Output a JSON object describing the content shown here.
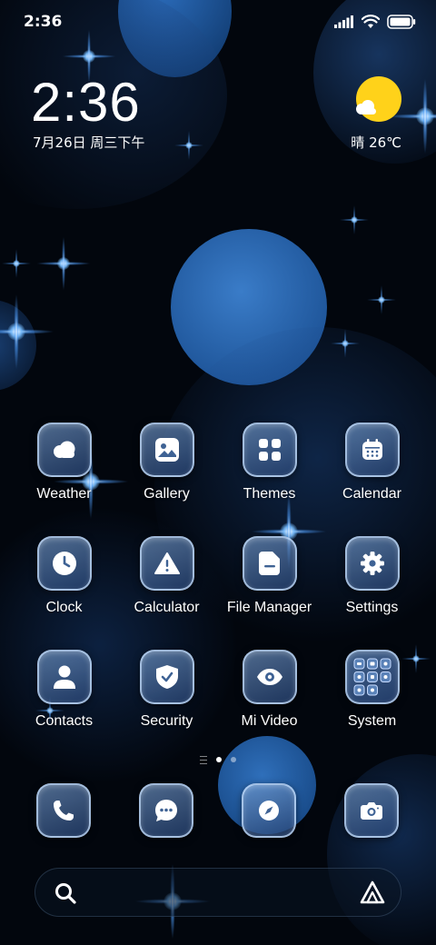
{
  "status_bar": {
    "time": "2:36",
    "icons": [
      "signal-icon",
      "wifi-icon",
      "battery-icon"
    ]
  },
  "clock_widget": {
    "time": "2:36",
    "date": "7月26日 周三下午"
  },
  "weather_widget": {
    "condition_icon": "sunny-cloud-icon",
    "text": "晴 26℃"
  },
  "apps": [
    {
      "label": "Weather",
      "icon": "cloud-icon"
    },
    {
      "label": "Gallery",
      "icon": "image-icon"
    },
    {
      "label": "Themes",
      "icon": "grid-icon"
    },
    {
      "label": "Calendar",
      "icon": "calendar-icon"
    },
    {
      "label": "Clock",
      "icon": "clock-icon"
    },
    {
      "label": "Calculator",
      "icon": "warning-triangle-icon"
    },
    {
      "label": "File Manager",
      "icon": "folder-icon"
    },
    {
      "label": "Settings",
      "icon": "gear-icon"
    },
    {
      "label": "Contacts",
      "icon": "person-icon"
    },
    {
      "label": "Security",
      "icon": "shield-check-icon"
    },
    {
      "label": "Mi Video",
      "icon": "eye-icon"
    },
    {
      "label": "System",
      "icon": "folder-grid-icon"
    }
  ],
  "pager": {
    "pages": 2,
    "current": 1
  },
  "dock": [
    {
      "icon": "phone-icon"
    },
    {
      "icon": "message-icon"
    },
    {
      "icon": "compass-icon"
    },
    {
      "icon": "camera-icon"
    }
  ],
  "search": {
    "icon": "search-icon",
    "assistant_icon": "assistant-icon"
  },
  "colors": {
    "background": "#02060d",
    "bubble": "#1f5fa8",
    "sun": "#ffd21a",
    "icon_tile": "#3e6294"
  }
}
